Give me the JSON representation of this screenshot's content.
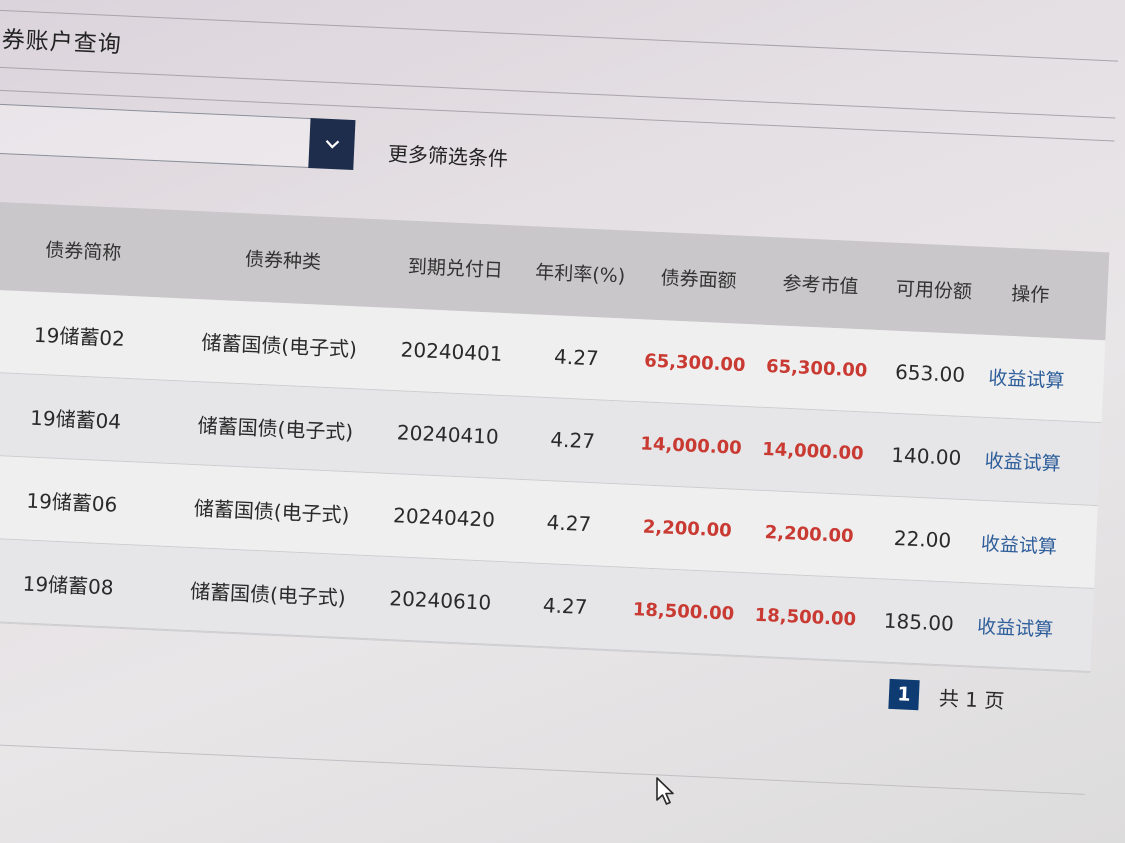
{
  "page": {
    "title": "债券账户查询",
    "more_filters": "更多筛选条件"
  },
  "table": {
    "columns": [
      "债券简称",
      "债券种类",
      "到期兑付日",
      "年利率(%)",
      "债券面额",
      "参考市值",
      "可用份额",
      "操作"
    ],
    "rows": [
      {
        "name": "19储蓄02",
        "type": "储蓄国债(电子式)",
        "maturity": "20240401",
        "rate": "4.27",
        "face": "65,300.00",
        "market": "65,300.00",
        "available": "653.00",
        "action": "收益试算"
      },
      {
        "name": "19储蓄04",
        "type": "储蓄国债(电子式)",
        "maturity": "20240410",
        "rate": "4.27",
        "face": "14,000.00",
        "market": "14,000.00",
        "available": "140.00",
        "action": "收益试算"
      },
      {
        "name": "19储蓄06",
        "type": "储蓄国债(电子式)",
        "maturity": "20240420",
        "rate": "4.27",
        "face": "2,200.00",
        "market": "2,200.00",
        "available": "22.00",
        "action": "收益试算"
      },
      {
        "name": "19储蓄08",
        "type": "储蓄国债(电子式)",
        "maturity": "20240610",
        "rate": "4.27",
        "face": "18,500.00",
        "market": "18,500.00",
        "available": "185.00",
        "action": "收益试算"
      }
    ]
  },
  "pagination": {
    "current": "1",
    "total_label": "共 1 页"
  },
  "colors": {
    "accent_dark": "#1f2d4d",
    "money_red": "#c83a32",
    "link_blue": "#2f5f9b",
    "page_active": "#0e3c72"
  },
  "icons": {
    "dropdown": "chevron-down-icon",
    "pointer": "mouse-cursor-icon"
  }
}
